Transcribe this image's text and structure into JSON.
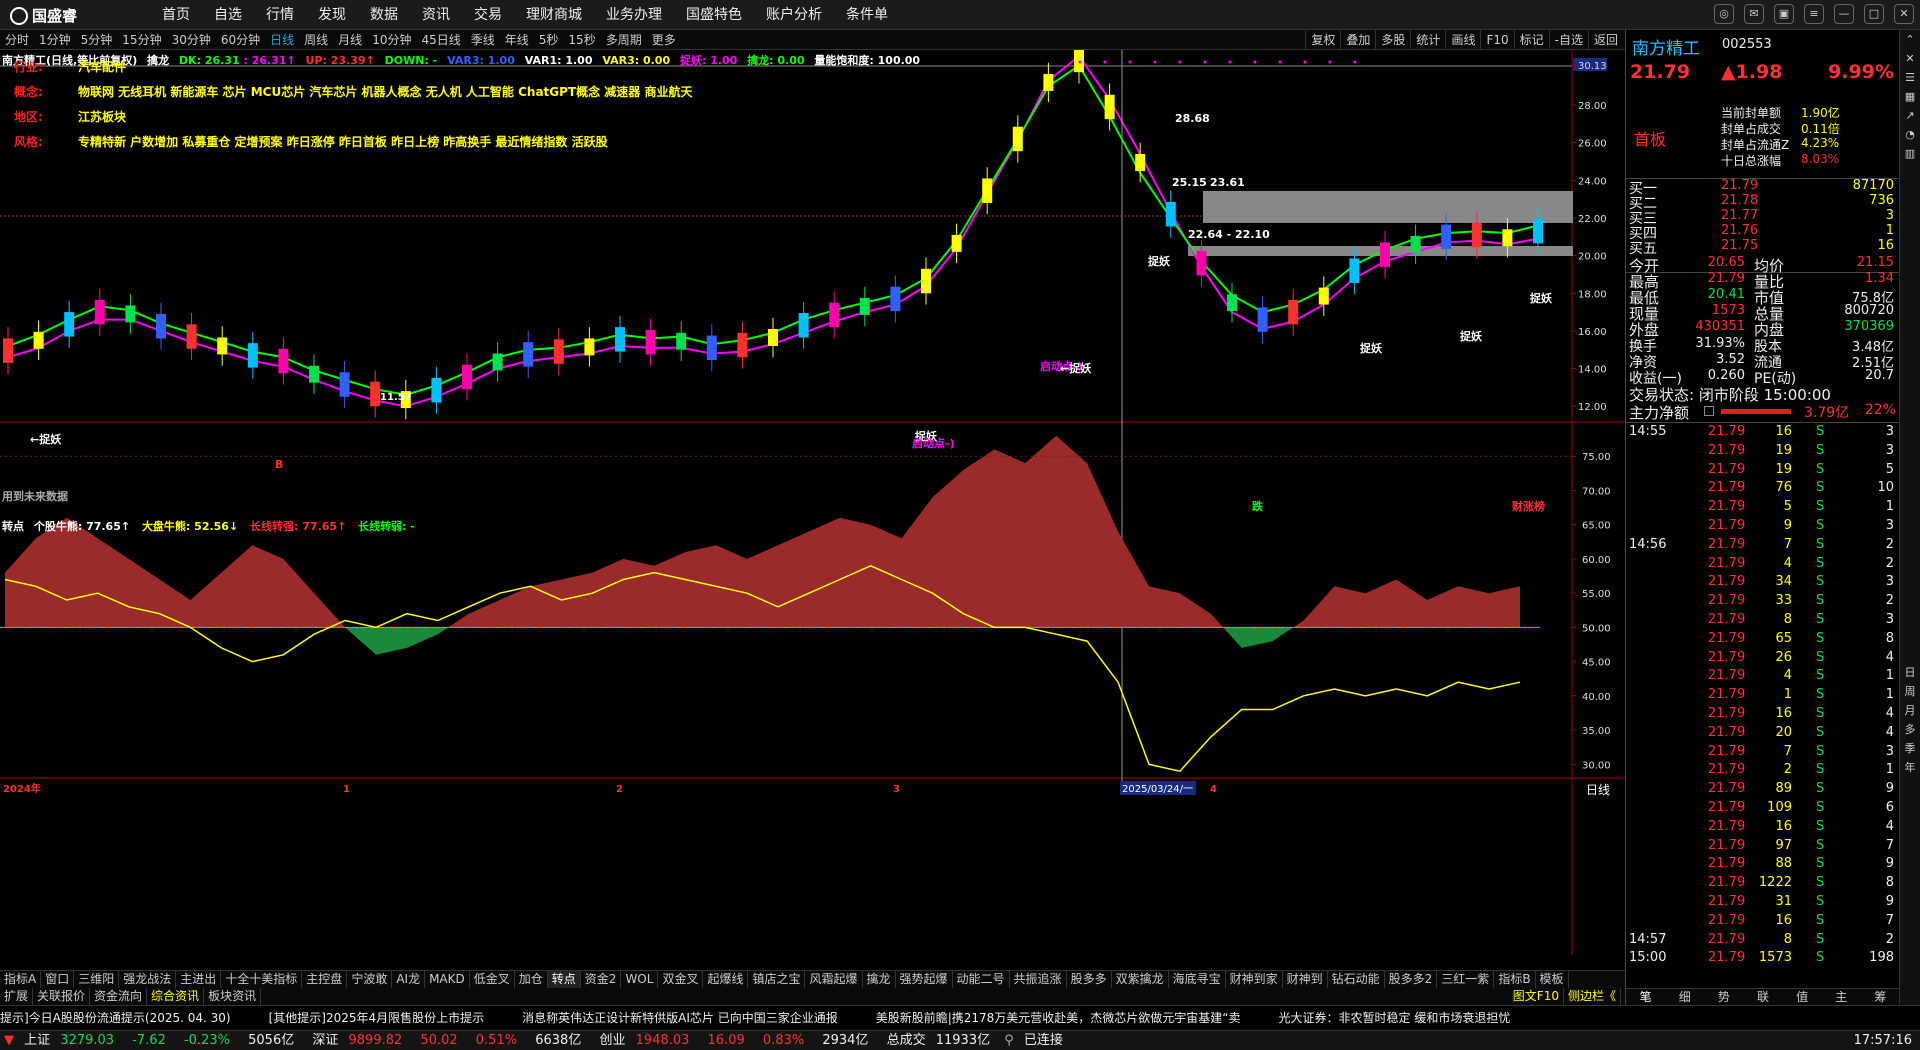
{
  "app": {
    "brand": "国盛睿"
  },
  "nav": [
    "首页",
    "自选",
    "行情",
    "发现",
    "数据",
    "资讯",
    "交易",
    "理财商城",
    "业务办理",
    "国盛特色",
    "账户分析",
    "条件单"
  ],
  "period_tabs": [
    "分时",
    "1分钟",
    "5分钟",
    "15分钟",
    "30分钟",
    "60分钟",
    "日线",
    "周线",
    "月线",
    "10分钟",
    "45日线",
    "季线",
    "年线",
    "5秒",
    "15秒",
    "多周期",
    "更多"
  ],
  "period_active": "日线",
  "tool_buttons": [
    "复权",
    "叠加",
    "多股",
    "统计",
    "画线",
    "F10",
    "标记",
    "-自选",
    "返回"
  ],
  "legend_main": {
    "title": "南方精工(日线,等比前复权)",
    "indicator": "擒龙",
    "dk": "DK: 26.31",
    "dk2": ": 26.31↑",
    "up": "UP: 23.39↑",
    "down": "DOWN: -",
    "var3": "VAR3: 1.00",
    "var1": "VAR1: 1.00",
    "var3b": "VAR3: 0.00",
    "zhuoyao": "捉妖: 1.00",
    "qinlong": "擒龙: 0.00",
    "liangneng": "量能饱和度: 100.00"
  },
  "info": [
    {
      "k": "行业:",
      "v": "汽车配件"
    },
    {
      "k": "概念:",
      "v": "物联网 无线耳机 新能源车 芯片 MCU芯片 汽车芯片 机器人概念 无人机 人工智能 ChatGPT概念 减速器 商业航天"
    },
    {
      "k": "地区:",
      "v": "江苏板块"
    },
    {
      "k": "风格:",
      "v": "专精特新 户数增加 私募重仓 定增预案 昨日涨停 昨日首板 昨日上榜 昨高换手 最近情绪指数 活跃股"
    }
  ],
  "price_axis": [
    "30.13",
    "28.00",
    "26.00",
    "24.00",
    "22.00",
    "20.00",
    "18.00",
    "16.00",
    "14.00",
    "12.00"
  ],
  "annotations": {
    "p1": "28.68",
    "p2": "25.15",
    "p3": "23.61",
    "p4": "22.64 - 22.10",
    "low": "11.57",
    "zhuoyao": "捉妖",
    "qidong": "启动点-)",
    "leftzy": "←捉妖",
    "b": "B",
    "nofuture": "用到未来数据",
    "die": "跌",
    "caizhang": "财涨榜"
  },
  "legend_sub": {
    "name": "转点",
    "a": "个股牛熊: 77.65↑",
    "b": "大盘牛熊: 52.56↓",
    "c": "长线转强: 77.65↑",
    "d": "长线转弱: -"
  },
  "sub_axis": [
    "75.00",
    "70.00",
    "65.00",
    "60.00",
    "55.00",
    "50.00",
    "45.00",
    "40.00",
    "35.00",
    "30.00"
  ],
  "date_axis": {
    "y2024": "2024年",
    "m1": "1",
    "m2": "2",
    "m3": "3",
    "cursor": "2025/03/24/一",
    "m4": "4",
    "period": "日线"
  },
  "indicator_tabs": [
    "指标A",
    "窗口",
    "三维阳",
    "强龙战法",
    "主进出",
    "十全十美指标",
    "主控盘",
    "宁波敢",
    "AI龙",
    "MAKD",
    "低金叉",
    "加仓",
    "转点",
    "资金2",
    "WOL",
    "双金叉",
    "起爆线",
    "镇店之宝",
    "风霜起爆",
    "擒龙",
    "强势起爆",
    "动能二号",
    "共振追涨",
    "股多多",
    "双紫擒龙",
    "海底寻宝",
    "财神到家",
    "财神到",
    "钻石动能",
    "股多多2",
    "三红一紫",
    "指标B",
    "模板"
  ],
  "indicator_active": "转点",
  "bottom_tabs": [
    "扩展",
    "关联报价",
    "资金流向",
    "综合资讯",
    "板块资讯"
  ],
  "bottom_active": "综合资讯",
  "bottom_right": [
    "图文F10",
    "侧边栏《"
  ],
  "quote": {
    "name": "南方精工",
    "code": "002553",
    "price": "21.79",
    "change": "▲1.98",
    "pct": "9.99%",
    "board": "首板",
    "seal": [
      {
        "k": "当前封单额",
        "v": "1.90亿"
      },
      {
        "k": "封单占成交",
        "v": "0.11倍"
      },
      {
        "k": "封单占流通Z",
        "v": "4.23%"
      },
      {
        "k": "十日总涨幅",
        "v": "8.03%"
      }
    ],
    "orders": [
      {
        "k": "买一",
        "p": "21.79",
        "v": "87170"
      },
      {
        "k": "买二",
        "p": "21.78",
        "v": "736"
      },
      {
        "k": "买三",
        "p": "21.77",
        "v": "3"
      },
      {
        "k": "买四",
        "p": "21.76",
        "v": "1"
      },
      {
        "k": "买五",
        "p": "21.75",
        "v": "16"
      }
    ],
    "stats": [
      {
        "k1": "今开",
        "v1": "20.65",
        "k2": "均价",
        "v2": "21.15"
      },
      {
        "k1": "最高",
        "v1": "21.79",
        "k2": "量比",
        "v2": "1.34"
      },
      {
        "k1": "最低",
        "v1": "20.41",
        "k2": "市值",
        "v2": "75.8亿"
      },
      {
        "k1": "现量",
        "v1": "1573",
        "k2": "总量",
        "v2": "800720"
      },
      {
        "k1": "外盘",
        "v1": "430351",
        "k2": "内盘",
        "v2": "370369"
      }
    ],
    "stats2": [
      {
        "k1": "换手",
        "v1": "31.93%",
        "k2": "股本",
        "v2": "3.48亿"
      },
      {
        "k1": "净资",
        "v1": "3.52",
        "k2": "流通",
        "v2": "2.51亿"
      },
      {
        "k1": "收益(一)",
        "v1": "0.260",
        "k2": "PE(动)",
        "v2": "20.7"
      }
    ],
    "status": "交易状态: 闭市阶段 15:00:00",
    "main_net": {
      "k": "主力净额",
      "v": "3.79亿",
      "pct": "22%"
    }
  },
  "ticks": [
    {
      "t": "14:55",
      "p": "21.79",
      "v": "16",
      "s": "S",
      "n": "3"
    },
    {
      "t": "",
      "p": "21.79",
      "v": "19",
      "s": "S",
      "n": "3"
    },
    {
      "t": "",
      "p": "21.79",
      "v": "19",
      "s": "S",
      "n": "5"
    },
    {
      "t": "",
      "p": "21.79",
      "v": "76",
      "s": "S",
      "n": "10"
    },
    {
      "t": "",
      "p": "21.79",
      "v": "5",
      "s": "S",
      "n": "1"
    },
    {
      "t": "",
      "p": "21.79",
      "v": "9",
      "s": "S",
      "n": "3"
    },
    {
      "t": "14:56",
      "p": "21.79",
      "v": "7",
      "s": "S",
      "n": "2"
    },
    {
      "t": "",
      "p": "21.79",
      "v": "4",
      "s": "S",
      "n": "2"
    },
    {
      "t": "",
      "p": "21.79",
      "v": "34",
      "s": "S",
      "n": "3"
    },
    {
      "t": "",
      "p": "21.79",
      "v": "33",
      "s": "S",
      "n": "2"
    },
    {
      "t": "",
      "p": "21.79",
      "v": "8",
      "s": "S",
      "n": "3"
    },
    {
      "t": "",
      "p": "21.79",
      "v": "65",
      "s": "S",
      "n": "8"
    },
    {
      "t": "",
      "p": "21.79",
      "v": "26",
      "s": "S",
      "n": "4"
    },
    {
      "t": "",
      "p": "21.79",
      "v": "4",
      "s": "S",
      "n": "1"
    },
    {
      "t": "",
      "p": "21.79",
      "v": "1",
      "s": "S",
      "n": "1"
    },
    {
      "t": "",
      "p": "21.79",
      "v": "16",
      "s": "S",
      "n": "4"
    },
    {
      "t": "",
      "p": "21.79",
      "v": "20",
      "s": "S",
      "n": "4"
    },
    {
      "t": "",
      "p": "21.79",
      "v": "7",
      "s": "S",
      "n": "3"
    },
    {
      "t": "",
      "p": "21.79",
      "v": "2",
      "s": "S",
      "n": "1"
    },
    {
      "t": "",
      "p": "21.79",
      "v": "89",
      "s": "S",
      "n": "9"
    },
    {
      "t": "",
      "p": "21.79",
      "v": "109",
      "s": "S",
      "n": "6"
    },
    {
      "t": "",
      "p": "21.79",
      "v": "16",
      "s": "S",
      "n": "4"
    },
    {
      "t": "",
      "p": "21.79",
      "v": "97",
      "s": "S",
      "n": "7"
    },
    {
      "t": "",
      "p": "21.79",
      "v": "88",
      "s": "S",
      "n": "9"
    },
    {
      "t": "",
      "p": "21.79",
      "v": "1222",
      "s": "S",
      "n": "8"
    },
    {
      "t": "",
      "p": "21.79",
      "v": "31",
      "s": "S",
      "n": "9"
    },
    {
      "t": "",
      "p": "21.79",
      "v": "16",
      "s": "S",
      "n": "7"
    },
    {
      "t": "14:57",
      "p": "21.79",
      "v": "8",
      "s": "S",
      "n": "2"
    },
    {
      "t": "15:00",
      "p": "21.79",
      "v": "1573",
      "s": "S",
      "n": "198"
    }
  ],
  "quote_tabs": [
    "笔",
    "细",
    "势",
    "联",
    "值",
    "主",
    "筹"
  ],
  "sidebar": [
    "日",
    "周",
    "月",
    "多",
    "季",
    "年"
  ],
  "news": [
    "提示]今日A股股份流通提示(2025. 04. 30)",
    "[其他提示]2025年4月限售股份上市提示",
    "消息称英伟达正设计新特供版AI芯片  已向中国三家企业通报",
    "美股新股前瞻|携2178万美元营收赴美，杰微芯片欲做元宇宙基建“卖",
    "光大证券：非农暂时稳定  缓和市场衰退担忧",
    "招商宏观：美国下游或仍有“抢进口”需求  库存周期切换进程或将"
  ],
  "status": {
    "sh_name": "上证",
    "sh": "3279.03",
    "sh_chg": "-7.62",
    "sh_pct": "-0.23%",
    "sh_amt": "5056亿",
    "sz_name": "深证",
    "sz": "9899.82",
    "sz_chg": "50.02",
    "sz_pct": "0.51%",
    "sz_amt": "6638亿",
    "cy_name": "创业",
    "cy": "1948.03",
    "cy_chg": "16.09",
    "cy_pct": "0.83%",
    "cy_amt": "2934亿",
    "total_name": "总成交",
    "total": "11933亿",
    "conn": "已连接",
    "time": "17:57:16"
  },
  "chart_data": {
    "type": "candlestick",
    "series_main": [
      {
        "name": "擒龙 (green)",
        "values": [
          15.2,
          15.8,
          16.6,
          17.3,
          17.1,
          16.4,
          15.9,
          15.4,
          14.9,
          14.6,
          13.9,
          13.4,
          12.9,
          12.6,
          13.1,
          13.8,
          14.6,
          15.0,
          15.1,
          15.4,
          15.8,
          15.6,
          15.7,
          15.3,
          15.5,
          15.9,
          16.6,
          17.1,
          17.5,
          17.9,
          18.8,
          20.8,
          23.5,
          26.2,
          29.0,
          30.1,
          27.4,
          24.4,
          22.0,
          19.7,
          17.9,
          17.0,
          17.4,
          18.2,
          19.5,
          20.3,
          20.9,
          21.2,
          21.3,
          21.2,
          21.6
        ]
      },
      {
        "name": "UP (magenta)",
        "values": [
          14.6,
          15.1,
          16.0,
          16.6,
          16.6,
          16.0,
          15.4,
          14.9,
          14.4,
          14.1,
          13.4,
          12.8,
          12.3,
          12.0,
          12.5,
          13.2,
          14.0,
          14.4,
          14.6,
          14.8,
          15.2,
          15.1,
          15.1,
          14.8,
          14.9,
          15.3,
          15.9,
          16.5,
          17.0,
          17.4,
          18.4,
          20.4,
          23.3,
          26.1,
          29.3,
          30.6,
          28.3,
          25.4,
          22.3,
          19.4,
          17.0,
          16.1,
          16.5,
          17.4,
          18.8,
          19.7,
          20.2,
          20.7,
          20.8,
          20.6,
          20.9
        ]
      }
    ],
    "series_sub": [
      {
        "name": "个股牛熊",
        "values": [
          58,
          63,
          66,
          63,
          60,
          57,
          54,
          58,
          62,
          60,
          55,
          50,
          46,
          47,
          49,
          52,
          54,
          56,
          57,
          58,
          60,
          59,
          61,
          62,
          60,
          62,
          64,
          66,
          65,
          63,
          69,
          73,
          76,
          74,
          78,
          74,
          64,
          56,
          55,
          52,
          47,
          48,
          51,
          56,
          55,
          57,
          54,
          56,
          55,
          56
        ]
      },
      {
        "name": "大盘牛熊",
        "values": [
          57,
          56,
          54,
          55,
          53,
          52,
          50,
          47,
          45,
          46,
          49,
          51,
          50,
          52,
          51,
          53,
          55,
          56,
          54,
          55,
          57,
          58,
          57,
          56,
          55,
          53,
          55,
          57,
          59,
          57,
          55,
          52,
          50,
          50,
          49,
          48,
          42,
          30,
          29,
          34,
          38,
          38,
          40,
          41,
          40,
          41,
          40,
          42,
          41,
          42
        ]
      }
    ],
    "price_ylim": [
      11,
      30.13
    ],
    "sub_ylim": [
      28,
      80
    ],
    "xlabel": "",
    "ylabel": ""
  }
}
